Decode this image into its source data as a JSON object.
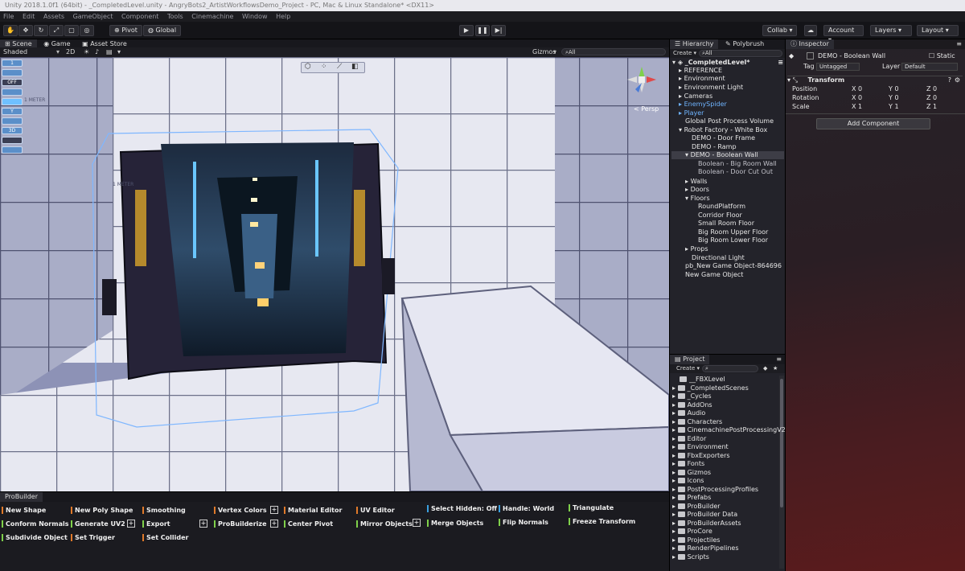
{
  "window": {
    "title": "Unity 2018.1.0f1 (64bit) - _CompletedLevel.unity - AngryBots2_ArtistWorkflowsDemo_Project - PC, Mac & Linux Standalone* <DX11>"
  },
  "menu": [
    "File",
    "Edit",
    "Assets",
    "GameObject",
    "Component",
    "Tools",
    "Cinemachine",
    "Window",
    "Help"
  ],
  "toolbar": {
    "pivot": "Pivot",
    "global": "Global",
    "collab": "Collab ▾",
    "account": "Account",
    "layers": "Layers",
    "layout": "Layout"
  },
  "scene": {
    "tabs": [
      "Scene",
      "Game",
      "Asset Store"
    ],
    "shading": "Shaded",
    "mode_2d": "2D",
    "gizmos": "Gizmos",
    "search_all": "All",
    "persp": "< Persp",
    "left_stack": [
      "1",
      "",
      "OFF",
      "",
      "",
      "Y",
      "",
      "3D"
    ]
  },
  "probuilder": {
    "tab": "ProBuilder",
    "buttons": [
      {
        "label": "New Shape",
        "color": "#e07a2a"
      },
      {
        "label": "New Poly Shape",
        "color": "#e07a2a"
      },
      {
        "label": "Smoothing",
        "color": "#e07a2a"
      },
      {
        "label": "Vertex Colors",
        "color": "#e07a2a"
      },
      {
        "label": "Material Editor",
        "color": "#e07a2a"
      },
      {
        "label": "UV Editor",
        "color": "#e07a2a"
      },
      {
        "label": "Select Hidden: Off",
        "color": "#3aa0e0"
      },
      {
        "label": "Handle: World",
        "color": "#3aa0e0"
      },
      {
        "label": "Triangulate",
        "color": "#7fd04a"
      },
      {
        "label": "Conform Normals",
        "color": "#7fd04a"
      },
      {
        "label": "Generate UV2",
        "color": "#7fd04a"
      },
      {
        "label": "Export",
        "color": "#7fd04a"
      },
      {
        "label": "ProBuilderize",
        "color": "#7fd04a"
      },
      {
        "label": "Center Pivot",
        "color": "#7fd04a"
      },
      {
        "label": "Mirror Objects",
        "color": "#7fd04a"
      },
      {
        "label": "Merge Objects",
        "color": "#7fd04a"
      },
      {
        "label": "Flip Normals",
        "color": "#7fd04a"
      },
      {
        "label": "Freeze Transform",
        "color": "#7fd04a"
      },
      {
        "label": "Subdivide Object",
        "color": "#7fd04a"
      },
      {
        "label": "Set Trigger",
        "color": "#e07a2a"
      },
      {
        "label": "Set Collider",
        "color": "#e07a2a"
      }
    ]
  },
  "hierarchy": {
    "tabs": [
      "Hierarchy",
      "Polybrush"
    ],
    "create": "Create ▾",
    "search": "All",
    "items": [
      "_CompletedLevel*",
      "REFERENCE",
      "Environment",
      "Environment Light",
      "Cameras",
      "EnemySpider",
      "Player",
      "Global Post Process Volume",
      "Robot Factory - White Box",
      "DEMO - Door Frame",
      "DEMO - Ramp",
      "DEMO - Boolean Wall",
      "Boolean - Big Room Wall",
      "Boolean - Door Cut Out",
      "Walls",
      "Doors",
      "Floors",
      "RoundPlatform",
      "Corridor Floor",
      "Small Room Floor",
      "Big Room Upper Floor",
      "Big Room Lower Floor",
      "Props",
      "Directional Light",
      "pb_New Game Object-864696",
      "New Game Object"
    ]
  },
  "project": {
    "tab": "Project",
    "create": "Create ▾",
    "folders": [
      "__FBXLevel",
      "_CompletedScenes",
      "_Cycles",
      "AddOns",
      "Audio",
      "Characters",
      "CinemachinePostProcessingV2",
      "Editor",
      "Environment",
      "FbxExporters",
      "Fonts",
      "Gizmos",
      "Icons",
      "PostProcessingProfiles",
      "Prefabs",
      "ProBuilder",
      "ProBuilder Data",
      "ProBuilderAssets",
      "ProCore",
      "Projectiles",
      "RenderPipelines",
      "Scripts"
    ]
  },
  "inspector": {
    "tab": "Inspector",
    "object_name": "DEMO - Boolean Wall",
    "static": "Static",
    "tag_label": "Tag",
    "tag_value": "Untagged",
    "layer_label": "Layer",
    "layer_value": "Default",
    "component": "Transform",
    "rows": [
      {
        "label": "Position",
        "x": "0",
        "y": "0",
        "z": "0"
      },
      {
        "label": "Rotation",
        "x": "0",
        "y": "0",
        "z": "0"
      },
      {
        "label": "Scale",
        "x": "1",
        "y": "1",
        "z": "1"
      }
    ],
    "add_component": "Add Component"
  }
}
